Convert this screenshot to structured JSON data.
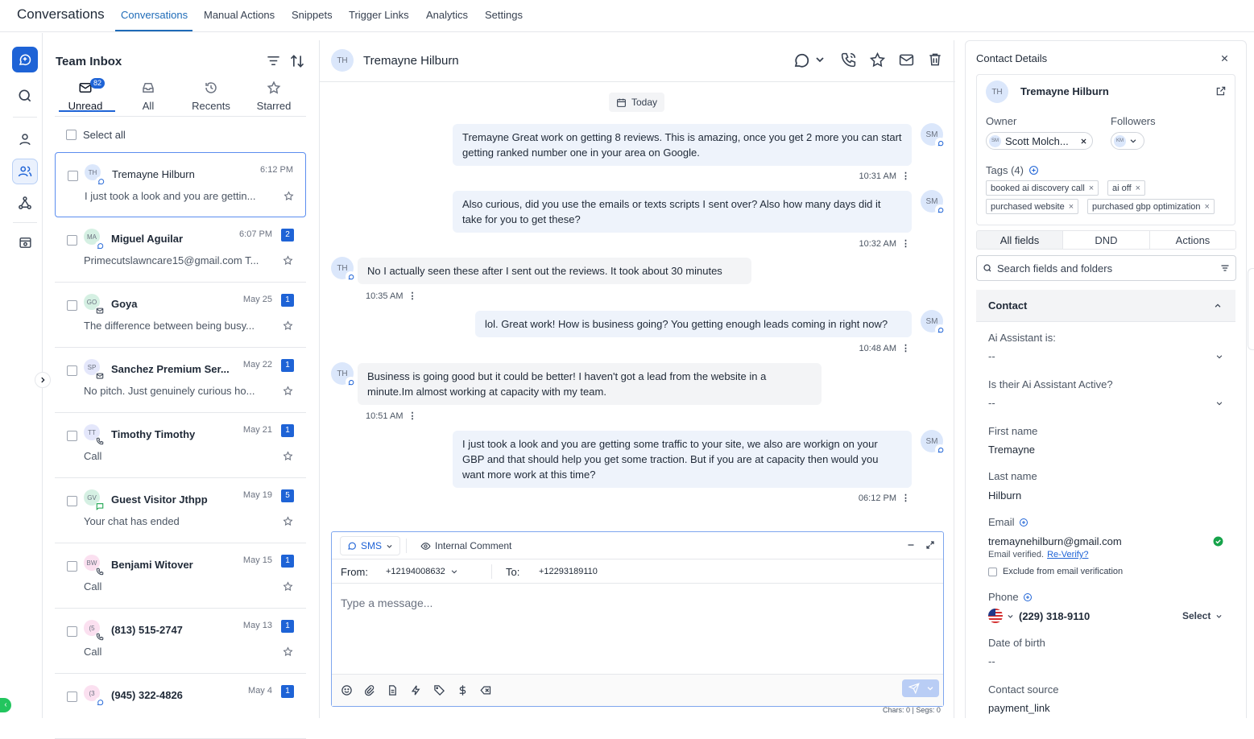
{
  "topnav": {
    "title": "Conversations",
    "tabs": [
      "Conversations",
      "Manual Actions",
      "Snippets",
      "Trigger Links",
      "Analytics",
      "Settings"
    ]
  },
  "inbox": {
    "title": "Team Inbox",
    "unread_count": "82",
    "filters": [
      "Unread",
      "All",
      "Recents",
      "Starred"
    ],
    "select_all": "Select all",
    "conversations": [
      {
        "initials": "TH",
        "name": "Tremayne Hilburn",
        "time": "6:12 PM",
        "count": "",
        "preview": "I just took a look and you are gettin...",
        "channel": "chat-icon",
        "avatar_color": "#dbe7fb"
      },
      {
        "initials": "MA",
        "name": "Miguel Aguilar",
        "time": "6:07 PM",
        "count": "2",
        "preview": "Primecutslawncare15@gmail.com T...",
        "channel": "chat-icon",
        "avatar_color": "#d5f0e3"
      },
      {
        "initials": "GO",
        "name": "Goya",
        "time": "May 25",
        "count": "1",
        "preview": "The difference between being busy...",
        "channel": "email-icon",
        "avatar_color": "#d5f0e3"
      },
      {
        "initials": "SP",
        "name": "Sanchez Premium Ser...",
        "time": "May 22",
        "count": "1",
        "preview": "No pitch. Just genuinely curious ho...",
        "channel": "email-icon",
        "avatar_color": "#e4e7fb"
      },
      {
        "initials": "TT",
        "name": "Timothy Timothy",
        "time": "May 21",
        "count": "1",
        "preview": "Call",
        "channel": "phone-icon",
        "avatar_color": "#e4e7fb"
      },
      {
        "initials": "GV",
        "name": "Guest Visitor Jthpp",
        "time": "May 19",
        "count": "5",
        "preview": "Your chat has ended",
        "channel": "livechat-icon",
        "avatar_color": "#d5f0e3"
      },
      {
        "initials": "BW",
        "name": "Benjami Witover",
        "time": "May 15",
        "count": "1",
        "preview": "Call",
        "channel": "phone-icon",
        "avatar_color": "#fbe0f0"
      },
      {
        "initials": "(5",
        "name": "(813) 515-2747",
        "time": "May 13",
        "count": "1",
        "preview": "Call",
        "channel": "phone-icon",
        "avatar_color": "#fbe0f0"
      },
      {
        "initials": "(3",
        "name": "(945) 322-4826",
        "time": "May 4",
        "count": "1",
        "preview": "",
        "channel": "chat-icon",
        "avatar_color": "#fbe0f0"
      }
    ]
  },
  "chat": {
    "contact_initials": "TH",
    "contact_name": "Tremayne Hilburn",
    "date_divider": "Today",
    "messages": [
      {
        "dir": "out",
        "initials": "SM",
        "text": "Tremayne Great work on getting 8 reviews. This is amazing, once you get 2 more you can start getting ranked number one in your area on Google.",
        "time": "10:31 AM"
      },
      {
        "dir": "out",
        "initials": "SM",
        "text": "Also curious, did you use the emails or texts scripts I sent over? Also how many days did it take for you to get these?",
        "time": "10:32 AM"
      },
      {
        "dir": "in",
        "initials": "TH",
        "text": "No I actually seen these after I sent out the reviews. It took about 30 minutes",
        "time": "10:35 AM"
      },
      {
        "dir": "out",
        "initials": "SM",
        "text": "lol. Great work! How is business going? You getting enough leads coming in right now?",
        "time": "10:48 AM"
      },
      {
        "dir": "in",
        "initials": "TH",
        "text": "Business is going good but it could be better! I haven't got a lead from the website in a minute.Im almost working at capacity with my team.",
        "time": "10:51 AM"
      },
      {
        "dir": "out",
        "initials": "SM",
        "text": "I just took a look and you are getting some traffic to your site, we also are workign on your GBP and that should help you get some traction. But if you are at capacity then would you want more work at this time?",
        "time": "06:12 PM"
      }
    ],
    "composer": {
      "channel": "SMS",
      "internal_comment": "Internal Comment",
      "from_label": "From:",
      "from_number": "+12194008632",
      "to_label": "To:",
      "to_number": "+12293189110",
      "placeholder": "Type a message...",
      "chars_status": "Chars: 0 | Segs: 0"
    }
  },
  "details": {
    "title": "Contact Details",
    "contact_initials": "TH",
    "contact_name": "Tremayne Hilburn",
    "owner_label": "Owner",
    "owner_initials": "SM",
    "owner_name": "Scott Molch...",
    "followers_label": "Followers",
    "follower_initials": "KM",
    "tags_label": "Tags (4)",
    "tags": [
      "booked ai discovery call",
      "ai off",
      "purchased website",
      "purchased gbp optimization"
    ],
    "tabs": [
      "All fields",
      "DND",
      "Actions"
    ],
    "search_placeholder": "Search fields and folders",
    "section_title": "Contact",
    "fields": {
      "ai_assistant_label": "Ai Assistant is:",
      "ai_assistant_value": "--",
      "ai_active_label": "Is their Ai Assistant Active?",
      "ai_active_value": "--",
      "first_name_label": "First name",
      "first_name_value": "Tremayne",
      "last_name_label": "Last name",
      "last_name_value": "Hilburn",
      "email_label": "Email",
      "email_value": "tremaynehilburn@gmail.com",
      "email_verified": "Email verified.",
      "reverify": "Re-Verify?",
      "exclude_label": "Exclude from email verification",
      "phone_label": "Phone",
      "phone_value": "(229) 318-9110",
      "phone_select": "Select",
      "dob_label": "Date of birth",
      "dob_value": "--",
      "source_label": "Contact source",
      "source_value": "payment_link"
    }
  },
  "colors": {
    "accent": "#1e63d6",
    "link": "#1e6bb8",
    "verified": "#16a34a"
  }
}
